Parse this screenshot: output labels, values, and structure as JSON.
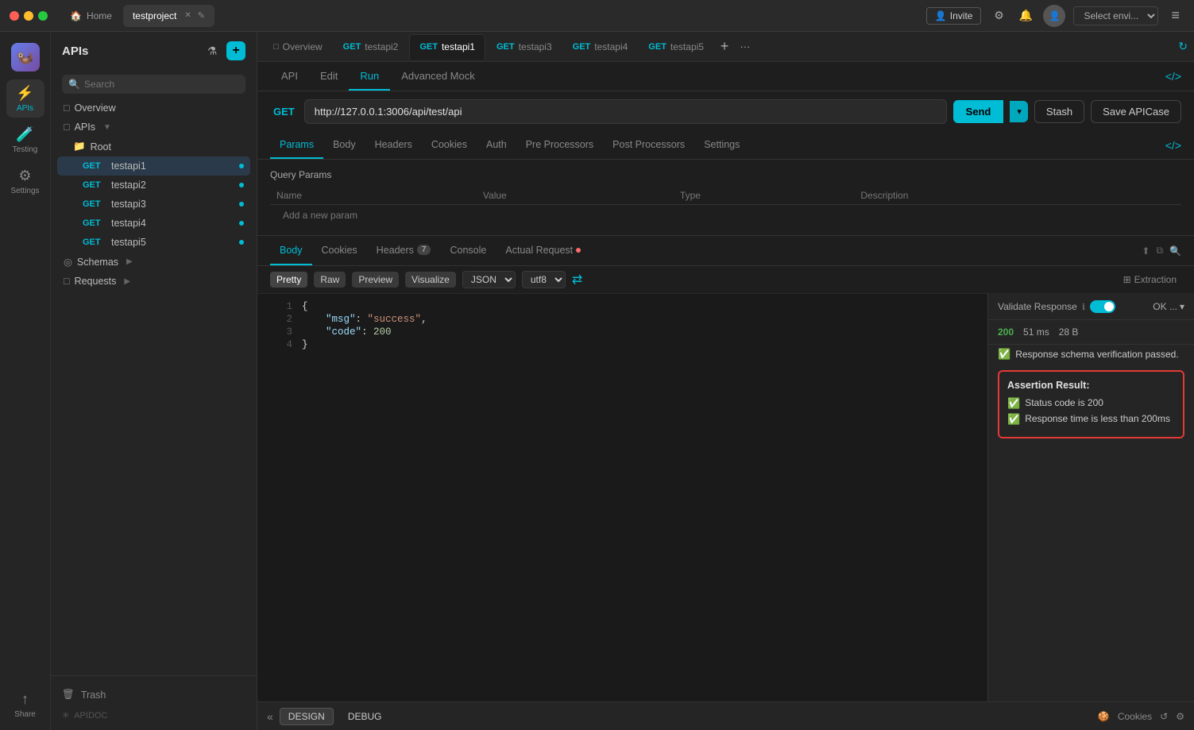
{
  "titlebar": {
    "traffic": [
      "red",
      "yellow",
      "green"
    ],
    "tabs": [
      {
        "id": "home",
        "label": "Home",
        "active": false
      },
      {
        "id": "testproject",
        "label": "testproject",
        "active": true,
        "closeable": true
      }
    ],
    "invite_label": "Invite",
    "env_placeholder": "Select envi...",
    "hamburger": "≡"
  },
  "dock": {
    "items": [
      {
        "id": "app-icon",
        "icon": "🦦",
        "label": ""
      },
      {
        "id": "apis",
        "label": "APIs",
        "active": true
      },
      {
        "id": "testing",
        "label": "Testing"
      },
      {
        "id": "settings",
        "label": "Settings"
      },
      {
        "id": "share",
        "label": "Share"
      }
    ]
  },
  "sidebar": {
    "title": "APIs",
    "search_placeholder": "Search",
    "tree": [
      {
        "type": "section",
        "label": "Overview",
        "icon": "□"
      },
      {
        "type": "section",
        "label": "APIs",
        "icon": "□",
        "has_arrow": true
      },
      {
        "type": "folder",
        "label": "Root"
      },
      {
        "type": "api",
        "method": "GET",
        "label": "testapi1",
        "selected": true
      },
      {
        "type": "api",
        "method": "GET",
        "label": "testapi2"
      },
      {
        "type": "api",
        "method": "GET",
        "label": "testapi3"
      },
      {
        "type": "api",
        "method": "GET",
        "label": "testapi4"
      },
      {
        "type": "api",
        "method": "GET",
        "label": "testapi5"
      },
      {
        "type": "section",
        "label": "Schemas",
        "icon": "◎",
        "has_arrow": true
      },
      {
        "type": "section",
        "label": "Requests",
        "icon": "□",
        "has_arrow": true
      }
    ],
    "trash_label": "Trash"
  },
  "api_tabs": [
    {
      "method": "",
      "label": "Overview",
      "active": false
    },
    {
      "method": "GET",
      "label": "testapi2",
      "active": false
    },
    {
      "method": "GET",
      "label": "testapi1",
      "active": true
    },
    {
      "method": "GET",
      "label": "testapi3",
      "active": false
    },
    {
      "method": "GET",
      "label": "testapi4",
      "active": false
    },
    {
      "method": "GET",
      "label": "testapi5",
      "active": false
    }
  ],
  "sub_tabs": [
    {
      "label": "API",
      "active": false
    },
    {
      "label": "Edit",
      "active": false
    },
    {
      "label": "Run",
      "active": true
    },
    {
      "label": "Advanced Mock",
      "active": false
    }
  ],
  "url_bar": {
    "method": "GET",
    "url": "http://127.0.0.1:3006/api/test/api",
    "send_label": "Send",
    "stash_label": "Stash",
    "save_label": "Save APICase"
  },
  "params_tabs": [
    {
      "label": "Params",
      "active": true
    },
    {
      "label": "Body",
      "active": false
    },
    {
      "label": "Headers",
      "active": false
    },
    {
      "label": "Cookies",
      "active": false
    },
    {
      "label": "Auth",
      "active": false
    },
    {
      "label": "Pre Processors",
      "active": false
    },
    {
      "label": "Post Processors",
      "active": false
    },
    {
      "label": "Settings",
      "active": false
    }
  ],
  "params_table": {
    "title": "Query Params",
    "headers": [
      "Name",
      "Value",
      "Type",
      "Description"
    ],
    "add_label": "Add a new param"
  },
  "response_tabs": [
    {
      "label": "Body",
      "active": true
    },
    {
      "label": "Cookies",
      "active": false
    },
    {
      "label": "Headers",
      "badge": "7",
      "active": false
    },
    {
      "label": "Console",
      "active": false
    },
    {
      "label": "Actual Request",
      "has_dot": true,
      "active": false
    }
  ],
  "code_toolbar": {
    "views": [
      "Pretty",
      "Raw",
      "Preview",
      "Visualize"
    ],
    "active_view": "Pretty",
    "format": "JSON",
    "encoding": "utf8",
    "extraction_label": "Extraction"
  },
  "code_content": [
    {
      "num": 1,
      "content": "{"
    },
    {
      "num": 2,
      "content": "    \"msg\": \"success\","
    },
    {
      "num": 3,
      "content": "    \"code\": 200"
    },
    {
      "num": 4,
      "content": "}"
    }
  ],
  "validate_pane": {
    "title": "Validate Response",
    "toggle_on": true,
    "ok_label": "OK ...",
    "status": {
      "code": "200",
      "ms": "51 ms",
      "bytes": "28 B"
    },
    "schema_check": "Response schema verification passed.",
    "assertion_title": "Assertion Result:",
    "assertions": [
      "Status code is 200",
      "Response time is less than 200ms"
    ]
  },
  "bottom_bar": {
    "design_label": "DESIGN",
    "debug_label": "DEBUG",
    "cookies_label": "Cookies",
    "collapse_icon": "«"
  }
}
